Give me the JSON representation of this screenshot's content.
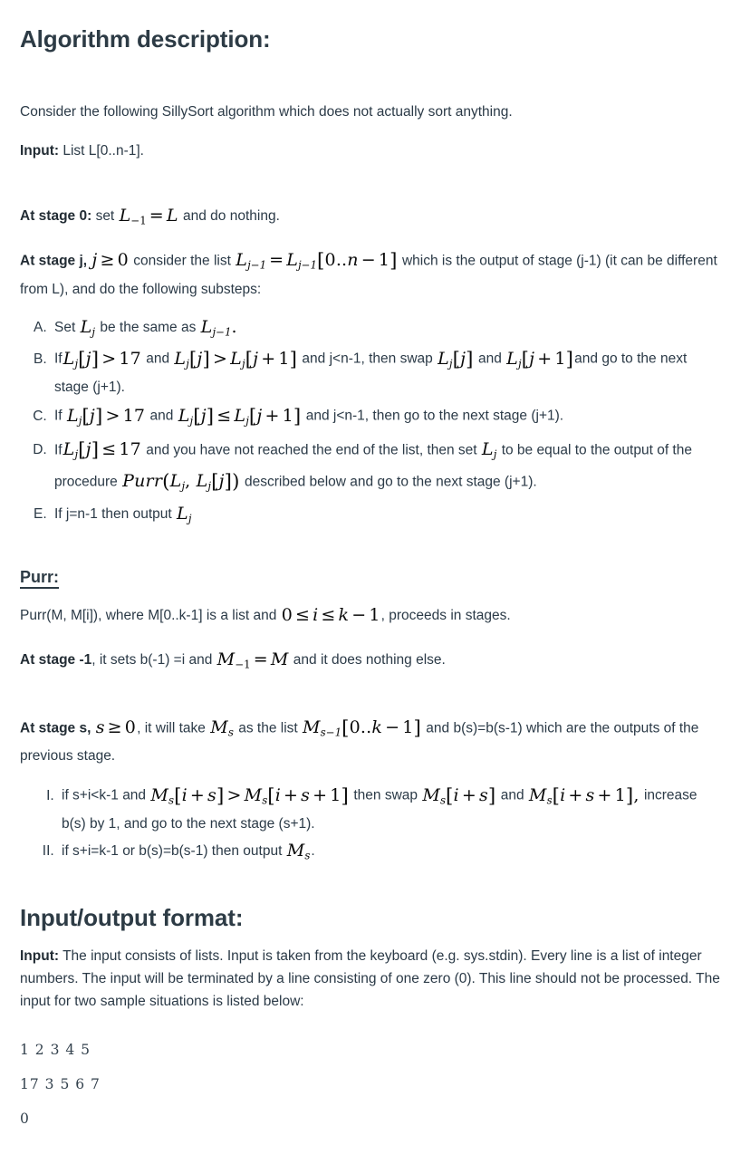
{
  "document": {
    "heading_1": "Algorithm description:",
    "intro": "Consider the following SillySort algorithm which does not actually sort anything.",
    "input_label": "Input:",
    "input_value": "List L[0..n-1].",
    "stage0_label": "At stage 0:",
    "stage0_text_1": "set",
    "stage0_math": "L−1 = L",
    "stage0_text_2": "and do nothing.",
    "stagej_label": "At stage j,",
    "stagej_math_cond": "j ≥ 0",
    "stagej_text_1": "consider the list",
    "stagej_math_list": "Lj−1 = Lj−1[0..n − 1]",
    "stagej_text_2": "which is the output of stage (j-1) (it can be different from L), and do the following substeps:",
    "substeps": [
      {
        "marker": "A.",
        "text_1": "Set",
        "math_1": "Lj",
        "text_2": "be the same as",
        "math_2": "Lj−1 ."
      },
      {
        "marker": "B.",
        "text_1": "If",
        "math_1": "Lj[j] > 17",
        "text_2": "and",
        "math_2": "Lj[j] > Lj[j + 1]",
        "text_3": "and j<n-1, then swap",
        "math_3": "Lj[j]",
        "text_4": "and",
        "math_4": "Lj[j + 1]",
        "text_5": "and go to the next stage (j+1)."
      },
      {
        "marker": "C.",
        "text_1": "If",
        "math_1": "Lj[j] > 17",
        "text_2": "and",
        "math_2": "Lj[j] ≤ Lj[j + 1]",
        "text_3": "and j<n-1, then go to the next stage (j+1)."
      },
      {
        "marker": "D.",
        "text_1": "If",
        "math_1": "Lj[j] ≤ 17",
        "text_2": "and you have not reached the end of the list, then set",
        "math_2": "Lj",
        "text_3": "to be equal to the output of the procedure",
        "math_3": "Purr(Lj , Lj[j])",
        "text_4": "described below and go to the next stage (j+1)."
      },
      {
        "marker": "E.",
        "text_1": "If j=n-1 then output",
        "math_1": "Lj"
      }
    ],
    "heading_2": "Purr:",
    "purr_intro_1": "Purr(M, M[i]), where M[0..k-1] is a list and",
    "purr_intro_math": "0 ≤ i ≤ k − 1",
    "purr_intro_2": ", proceeds in stages.",
    "purr_stage_m1_label": "At stage -1",
    "purr_stage_m1_text_1": ", it sets b(-1) =i and",
    "purr_stage_m1_math": "M−1 = M",
    "purr_stage_m1_text_2": "and it does nothing else.",
    "purr_stage_s_label": "At stage s,",
    "purr_stage_s_math_cond": "s ≥ 0",
    "purr_stage_s_text_1": ", it will take",
    "purr_stage_s_math_1": "Ms",
    "purr_stage_s_text_2": "as the list",
    "purr_stage_s_math_2": "Ms−1[0..k − 1]",
    "purr_stage_s_text_3": "and b(s)=b(s-1) which are the outputs of the previous stage.",
    "purr_steps": [
      {
        "marker": "I.",
        "text_1": "if s+i<k-1 and",
        "math_1": "Ms[i + s] > Ms[i + s + 1]",
        "text_2": "then swap",
        "math_2": "Ms[i + s]",
        "text_3": "and",
        "math_3": "Ms[i + s + 1],",
        "text_4": "increase b(s) by 1, and go to the next stage (s+1)."
      },
      {
        "marker": "II.",
        "text_1": "if s+i=k-1 or b(s)=b(s-1) then output",
        "math_1": "Ms",
        "text_2": "."
      }
    ],
    "heading_3": "Input/output format:",
    "io_input_label": "Input:",
    "io_input_text": "The input consists of lists. Input is taken from the keyboard (e.g. sys.stdin). Every line is a list of integer numbers.  The input will be terminated by a line consisting of one zero (0). This line should not be processed. The input for two sample situations is listed below:",
    "sample_lines": [
      "1 2 3 4 5",
      "17 3 5 6 7",
      "0"
    ]
  },
  "colors": {
    "heading": "#2d3b45",
    "body_text": "#2b3a47",
    "math_text": "#0b0b0b",
    "background": "#ffffff"
  }
}
